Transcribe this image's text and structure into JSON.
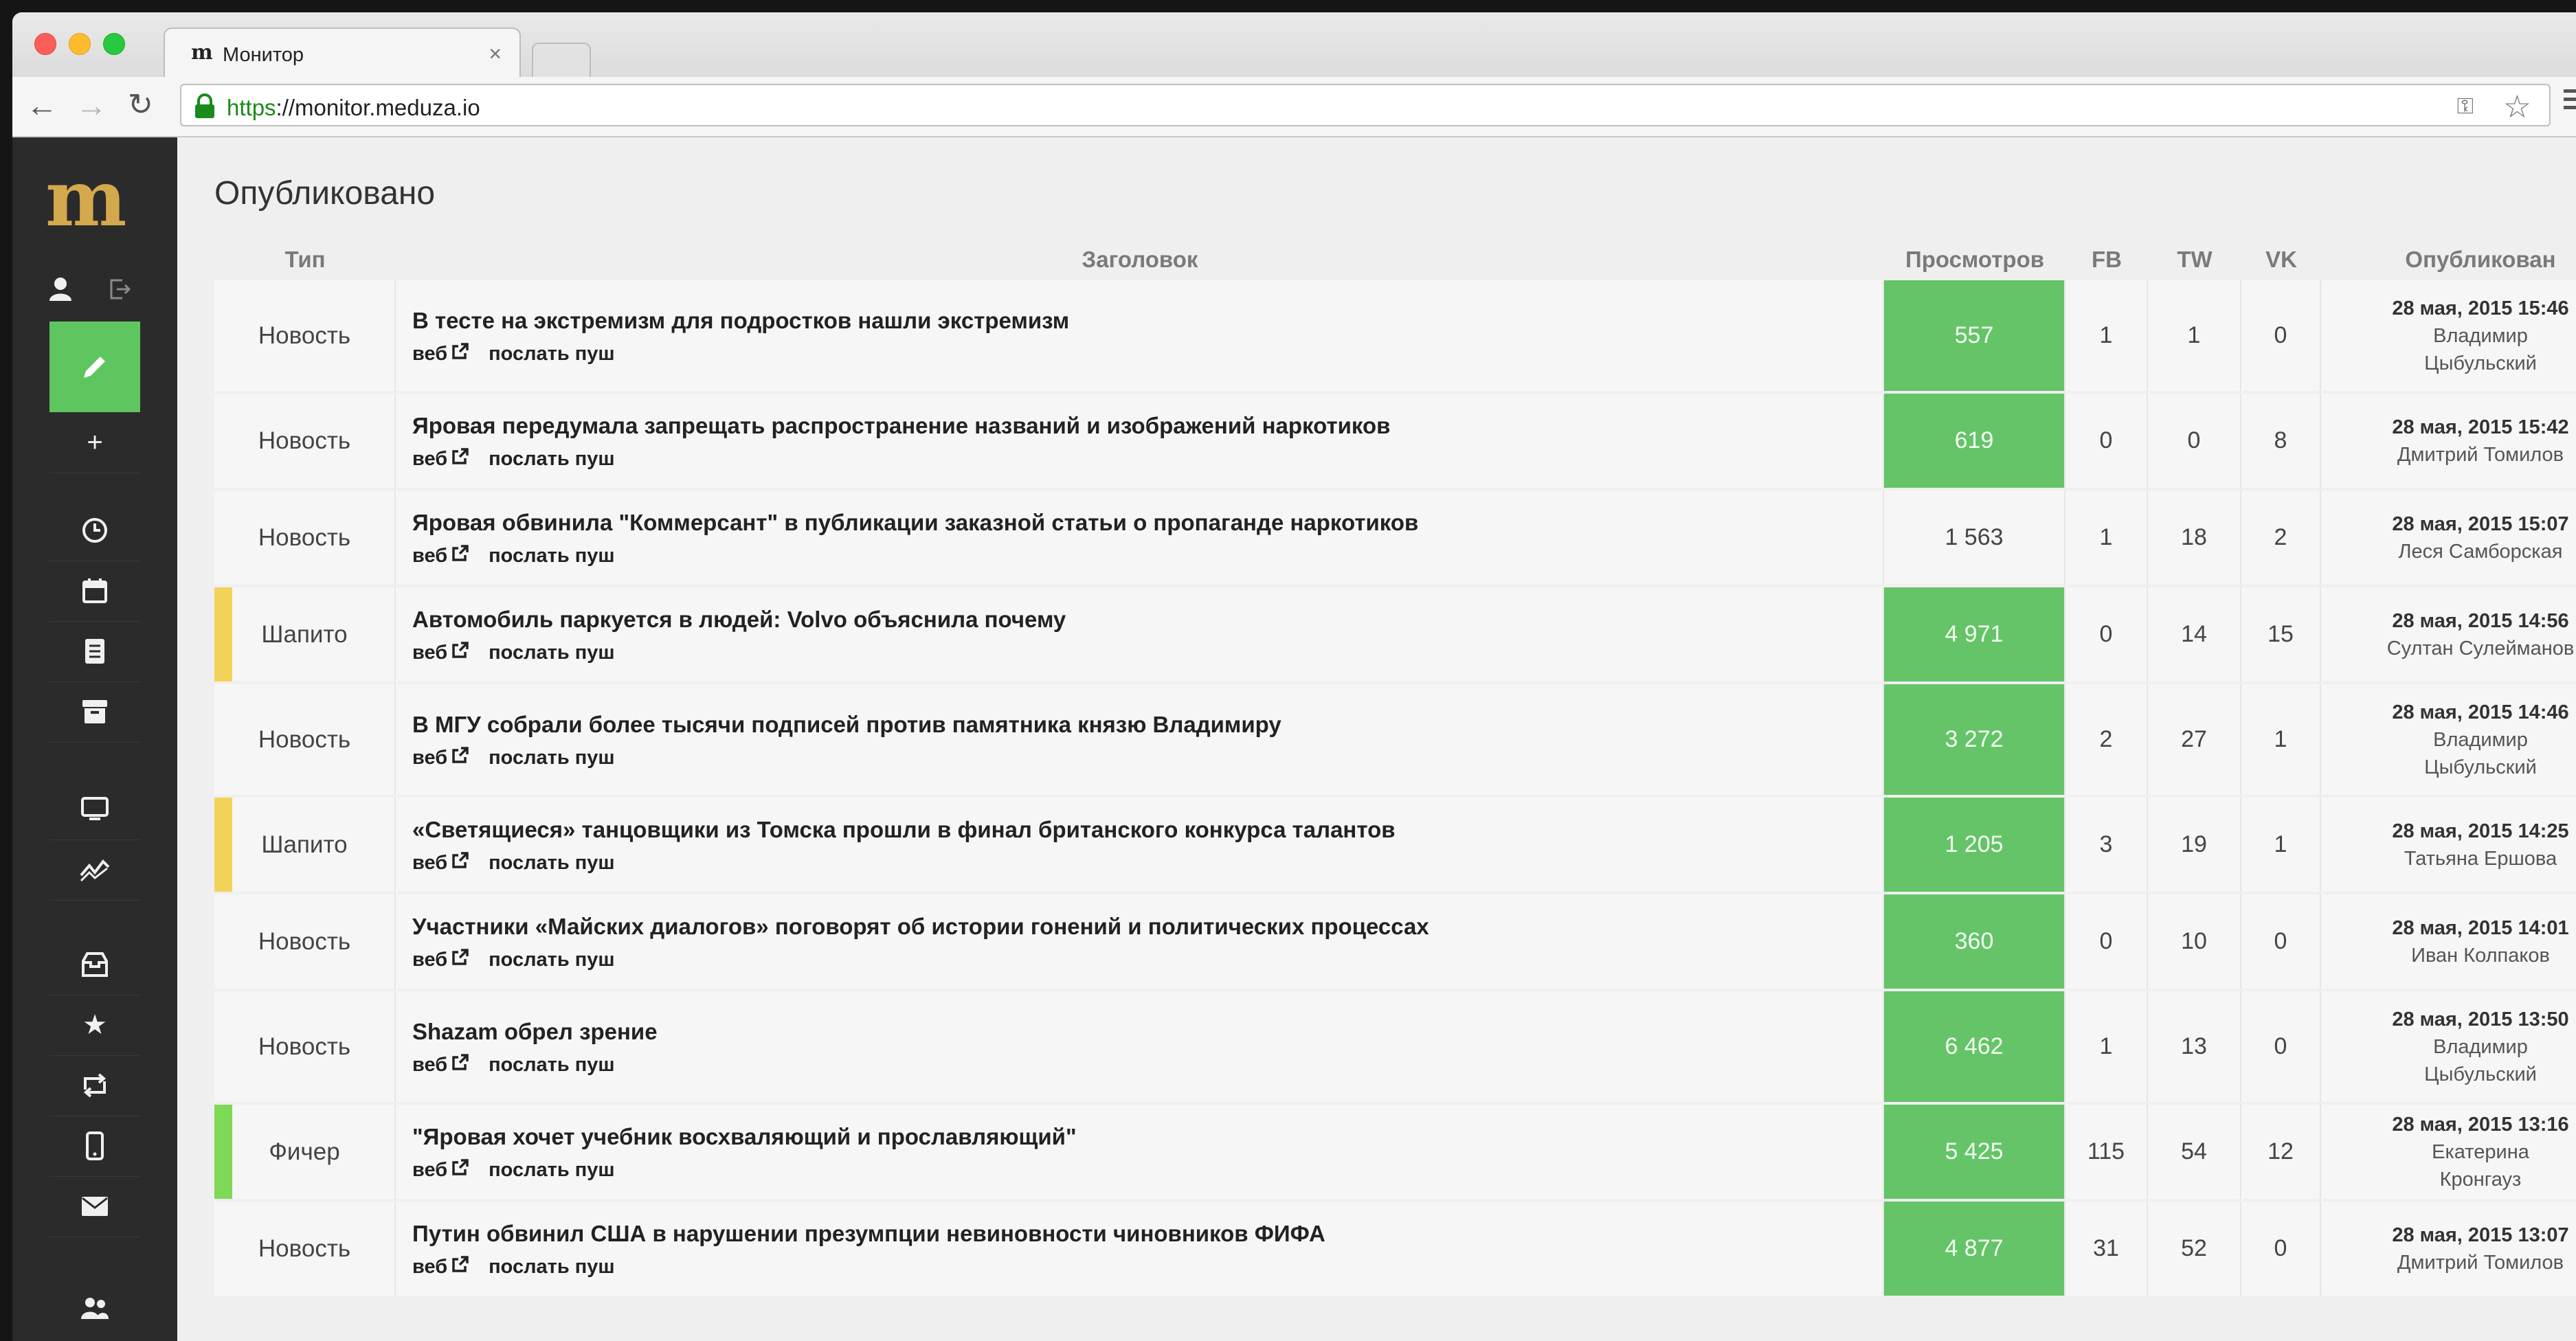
{
  "browser": {
    "tab_title": "Монитор",
    "tab_favicon": "m",
    "tab_close": "×",
    "url_scheme": "https",
    "url_rest": "://monitor.meduza.io"
  },
  "sidebar": {
    "logo": "m",
    "add": "+",
    "icons": [
      "user-icon",
      "logout-icon",
      "pencil-icon",
      "plus-icon",
      "clock-icon",
      "calendar-icon",
      "document-icon",
      "archive-icon",
      "monitor-icon",
      "chart-icon",
      "inbox-icon",
      "star-icon",
      "repost-icon",
      "mobile-icon",
      "mail-icon",
      "users-icon"
    ]
  },
  "page": {
    "title": "Опубликовано"
  },
  "table": {
    "headers": {
      "type": "Тип",
      "headline": "Заголовок",
      "views": "Просмотров",
      "fb": "FB",
      "tw": "TW",
      "vk": "VK",
      "published": "Опубликован"
    },
    "link_web": "веб",
    "link_push": "послать пуш",
    "rows": [
      {
        "type": "Новость",
        "title": "В тесте на экстремизм для подростков нашли экстремизм",
        "views": "557",
        "fb": "1",
        "tw": "1",
        "vk": "0",
        "date": "28 мая, 2015 15:46",
        "author": "Владимир Цыбульский"
      },
      {
        "type": "Новость",
        "title": "Яровая передумала запрещать распространение названий и изображений наркотиков",
        "views": "619",
        "fb": "0",
        "tw": "0",
        "vk": "8",
        "date": "28 мая, 2015 15:42",
        "author": "Дмитрий Томилов"
      },
      {
        "type": "Новость",
        "title": "Яровая обвинила \"Коммерсант\" в публикации заказной статьи о пропаганде наркотиков",
        "views": "1 563",
        "fb": "1",
        "tw": "18",
        "vk": "2",
        "date": "28 мая, 2015 15:07",
        "author": "Леся Самборская"
      },
      {
        "type": "Шапито",
        "title": "Автомобиль паркуется в людей: Volvo объяснила почему",
        "views": "4 971",
        "fb": "0",
        "tw": "14",
        "vk": "15",
        "date": "28 мая, 2015 14:56",
        "author": "Султан Сулейманов"
      },
      {
        "type": "Новость",
        "title": "В МГУ собрали более тысячи подписей против памятника князю Владимиру",
        "views": "3 272",
        "fb": "2",
        "tw": "27",
        "vk": "1",
        "date": "28 мая, 2015 14:46",
        "author": "Владимир Цыбульский"
      },
      {
        "type": "Шапито",
        "title": "«Светящиеся» танцовщики из Томска прошли в финал британского конкурса талантов",
        "views": "1 205",
        "fb": "3",
        "tw": "19",
        "vk": "1",
        "date": "28 мая, 2015 14:25",
        "author": "Татьяна Ершова"
      },
      {
        "type": "Новость",
        "title": "Участники «Майских диалогов» поговорят об истории гонений и политических процессах",
        "views": "360",
        "fb": "0",
        "tw": "10",
        "vk": "0",
        "date": "28 мая, 2015 14:01",
        "author": "Иван Колпаков"
      },
      {
        "type": "Новость",
        "title": "Shazam обрел зрение",
        "views": "6 462",
        "fb": "1",
        "tw": "13",
        "vk": "0",
        "date": "28 мая, 2015 13:50",
        "author": "Владимир Цыбульский"
      },
      {
        "type": "Фичер",
        "title": "\"Яровая хочет учебник восхваляющий и прославляющий\"",
        "views": "5 425",
        "fb": "115",
        "tw": "54",
        "vk": "12",
        "date": "28 мая, 2015 13:16",
        "author": "Екатерина Кронгауз"
      },
      {
        "type": "Новость",
        "title": "Путин обвинил США в нарушении презумпции невиновности чиновников ФИФА",
        "views": "4 877",
        "fb": "31",
        "tw": "52",
        "vk": "0",
        "date": "28 мая, 2015 13:07",
        "author": "Дмитрий Томилов"
      }
    ]
  },
  "colors": {
    "views_highlight": "#64c467",
    "type_shapito": "#f3d25a",
    "type_feature": "#7ed957",
    "logo": "#d4a94d",
    "sidebar_active": "#5fc55f"
  }
}
